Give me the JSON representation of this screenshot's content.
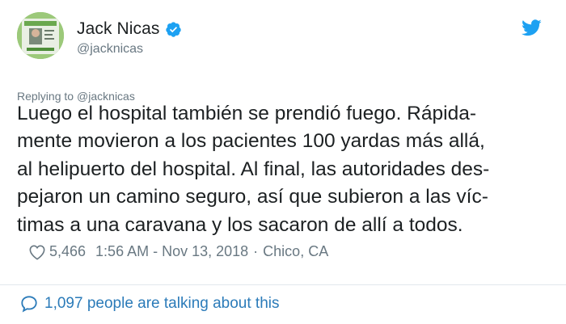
{
  "author": {
    "name": "Jack Nicas",
    "handle": "@jacknicas",
    "verified": true
  },
  "reply": {
    "prefix": "Replying to",
    "to": "@jacknicas"
  },
  "tweet": {
    "lines": [
      "Luego el hospital también se prendió fuego. Rápida-",
      "mente movieron a los pacientes 100 yardas más allá,",
      "al helipuerto del hospital. Al final, las autoridades des-",
      "pejaron un camino seguro, así que subieron a las víc-",
      "timas a una caravana y los sacaron de allí a todos."
    ]
  },
  "meta": {
    "likes": "5,466",
    "time": "1:56 AM - Nov 13, 2018",
    "separator": "·",
    "location": "Chico, CA"
  },
  "footer": {
    "talking_text": "1,097 people are talking about this"
  },
  "colors": {
    "text": "#1c2022",
    "muted": "#697882",
    "link": "#2b7bb9",
    "twitter_blue": "#1da1f2",
    "divider": "#e1e8ed"
  },
  "icons": {
    "verified": "verified-badge-icon",
    "bird": "twitter-bird-icon",
    "heart": "heart-icon",
    "bubble": "speech-bubble-icon"
  }
}
